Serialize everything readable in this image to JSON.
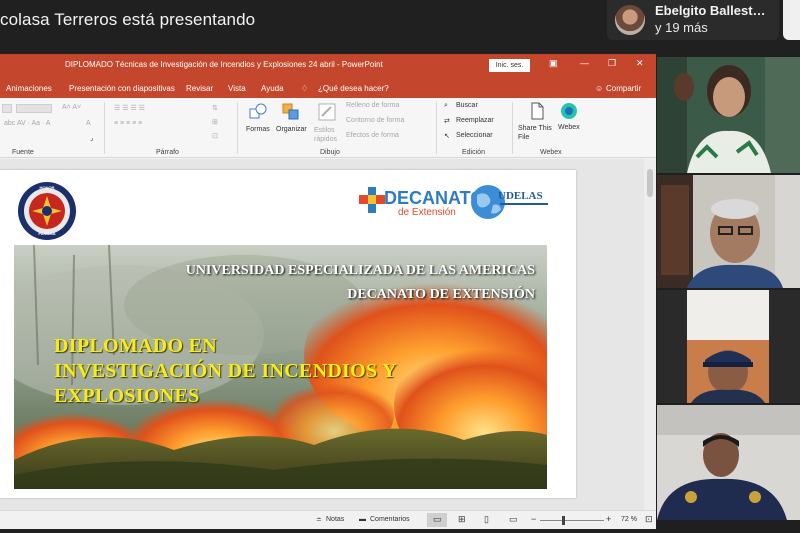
{
  "meeting": {
    "presenter_banner": "colasa Terreros está presentando",
    "participant_name": "Ebelgito Ballest…",
    "participant_more": "y 19 más"
  },
  "powerpoint": {
    "title": "DIPLOMADO Técnicas de Investigación de Incendios y Explosiones 24 abril  -  PowerPoint",
    "sign_in": "Inic. ses.",
    "menu": [
      "Animaciones",
      "Presentación con diapositivas",
      "Revisar",
      "Vista",
      "Ayuda",
      "¿Qué desea hacer?",
      "Compartir"
    ],
    "ribbon": {
      "groups": [
        "Fuente",
        "Párrafo",
        "Dibujo",
        "Edición",
        "Webex"
      ],
      "shapes": "Formas",
      "arrange": "Organizar",
      "styles": "Estilos rápidos",
      "fill": "Relleno de forma",
      "outline": "Contorno de forma",
      "effects": "Efectos de forma",
      "find": "Buscar",
      "replace": "Reemplazar",
      "select": "Seleccionar",
      "share_file": "Share This File",
      "webex": "Webex"
    },
    "status": {
      "notes": "Notas",
      "comments": "Comentarios",
      "zoom": "72 %"
    }
  },
  "slide": {
    "badge_top": "HONOR",
    "badge_bottom": "PANAMA",
    "decanato": "DECANATO",
    "decanato_sub": "de Extensión",
    "udelas": "UDELAS",
    "university": "UNIVERSIDAD ESPECIALIZADA DE LAS AMERICAS",
    "faculty": "DECANATO DE EXTENSIÓN",
    "title_lines": [
      "DIPLOMADO EN",
      "INVESTIGACIÓN DE INCENDIOS Y",
      "EXPLOSIONES"
    ]
  },
  "colors": {
    "ppt_accent": "#c4462d",
    "slide_title": "#f7ec17"
  }
}
